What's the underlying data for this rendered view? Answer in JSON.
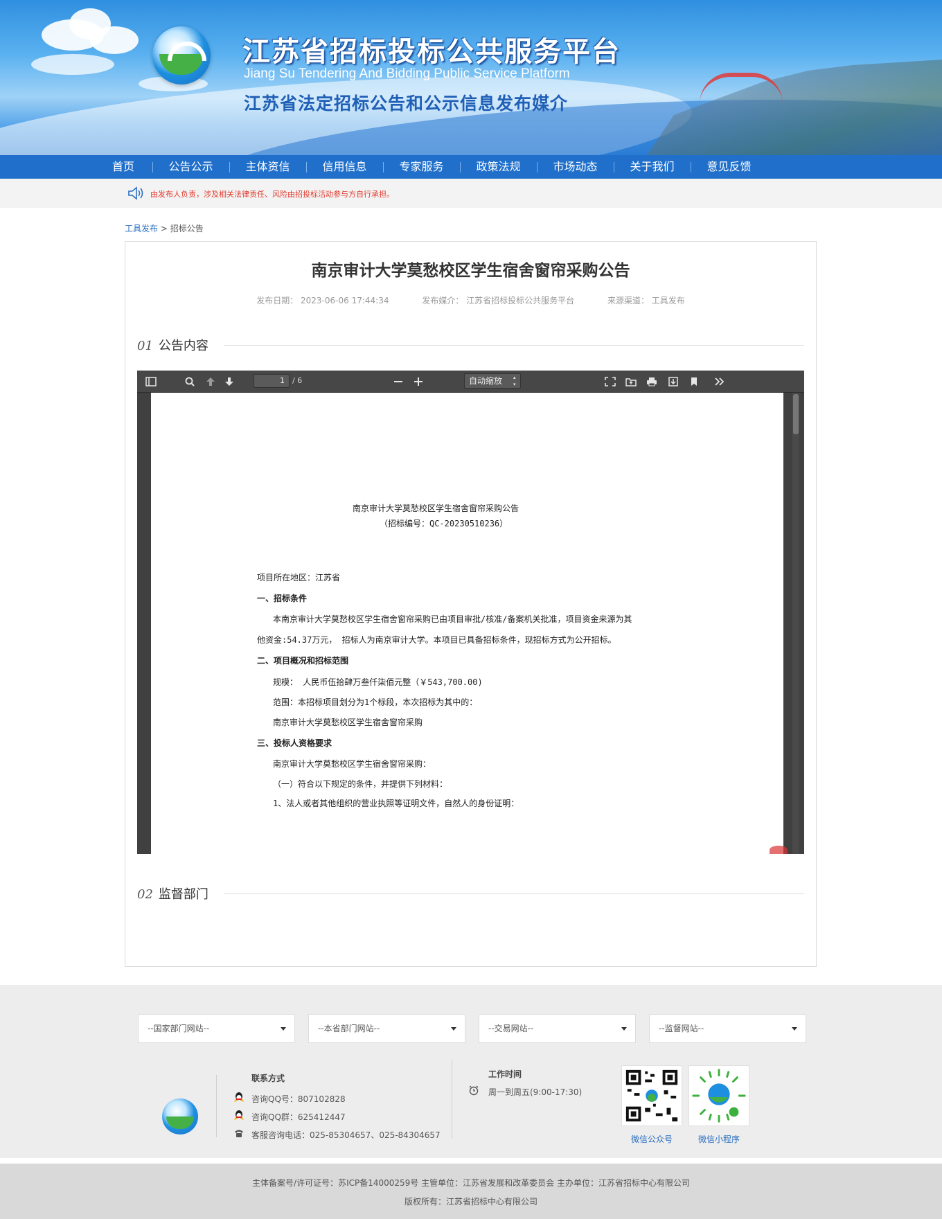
{
  "header": {
    "title_cn": "江苏省招标投标公共服务平台",
    "title_en": "Jiang Su Tendering And Bidding Public Service Platform",
    "slogan": "江苏省法定招标公告和公示信息发布媒介"
  },
  "nav": {
    "items": [
      "首页",
      "公告公示",
      "主体资信",
      "信用信息",
      "专家服务",
      "政策法规",
      "市场动态",
      "关于我们",
      "意见反馈"
    ]
  },
  "notice": {
    "icon": "speaker-icon",
    "text": "由发布人负责，涉及相关法律责任、风险由招投标活动参与方自行承担。"
  },
  "breadcrumb": {
    "link": "工具发布",
    "separator": ">",
    "current": "招标公告"
  },
  "article": {
    "title": "南京审计大学莫愁校区学生宿舍窗帘采购公告",
    "meta": {
      "date": "发布日期：  2023-06-06 17:44:34",
      "media": "发布媒介：  江苏省招标投标公共服务平台",
      "source": "来源渠道：  工具发布"
    },
    "section1": {
      "num": "01",
      "label": "公告内容"
    },
    "section2": {
      "num": "02",
      "label": "监督部门"
    }
  },
  "viewer": {
    "page_current": "1",
    "page_total": "/ 6",
    "zoom": "自动缩放",
    "icons": [
      "sidebar-toggle-icon",
      "search-icon",
      "previous-page-icon",
      "next-page-icon",
      "zoom-out-icon",
      "zoom-in-icon",
      "presentation-mode-icon",
      "open-file-icon",
      "print-icon",
      "download-icon",
      "bookmark-icon",
      "tools-icon"
    ],
    "doc": {
      "title": "南京审计大学莫愁校区学生宿舍窗帘采购公告",
      "code": "（招标编号：QC-20230510236）",
      "region": "项目所在地区：江苏省",
      "h1": "一、招标条件",
      "p1a": "本南京审计大学莫愁校区学生宿舍窗帘采购已由项目审批/核准/备案机关批准，项目资金来源为其",
      "p1b": "他资金:54.37万元，  招标人为南京审计大学。本项目已具备招标条件，现招标方式为公开招标。",
      "h2": "二、项目概况和招标范围",
      "scale": "规模：  人民币伍拾肆万叁仟柒佰元整（￥543,700.00)",
      "scope": "范围：本招标项目划分为1个标段，本次招标为其中的：",
      "lot": "南京审计大学莫愁校区学生宿舍窗帘采购",
      "h3": "三、投标人资格要求",
      "req": "南京审计大学莫愁校区学生宿舍窗帘采购：",
      "req1": "（一）符合以下规定的条件，并提供下列材料：",
      "req2": "1、法人或者其他组织的营业执照等证明文件，自然人的身份证明："
    }
  },
  "footer": {
    "selects": [
      "--国家部门网站--",
      "--本省部门网站--",
      "--交易网站--",
      "--监督网站--"
    ],
    "contact": {
      "heading": "联系方式",
      "qq": "咨询QQ号：807102828",
      "qq_group": "咨询QQ群：625412447",
      "phone": "客服咨询电话：025-85304657、025-84304657"
    },
    "hours": {
      "heading": "工作时间",
      "text": "周一到周五(9:00-17:30)"
    },
    "qr": [
      "微信公众号",
      "微信小程序"
    ],
    "copyright1": "主体备案号/许可证号：苏ICP备14000259号 主管单位：江苏省发展和改革委员会 主办单位：江苏省招标中心有限公司",
    "copyright2": "版权所有：江苏省招标中心有限公司"
  },
  "colors": {
    "nav_bg": "#1f6fcb",
    "notice_text": "#e23a2e",
    "link": "#2a6ec0"
  }
}
